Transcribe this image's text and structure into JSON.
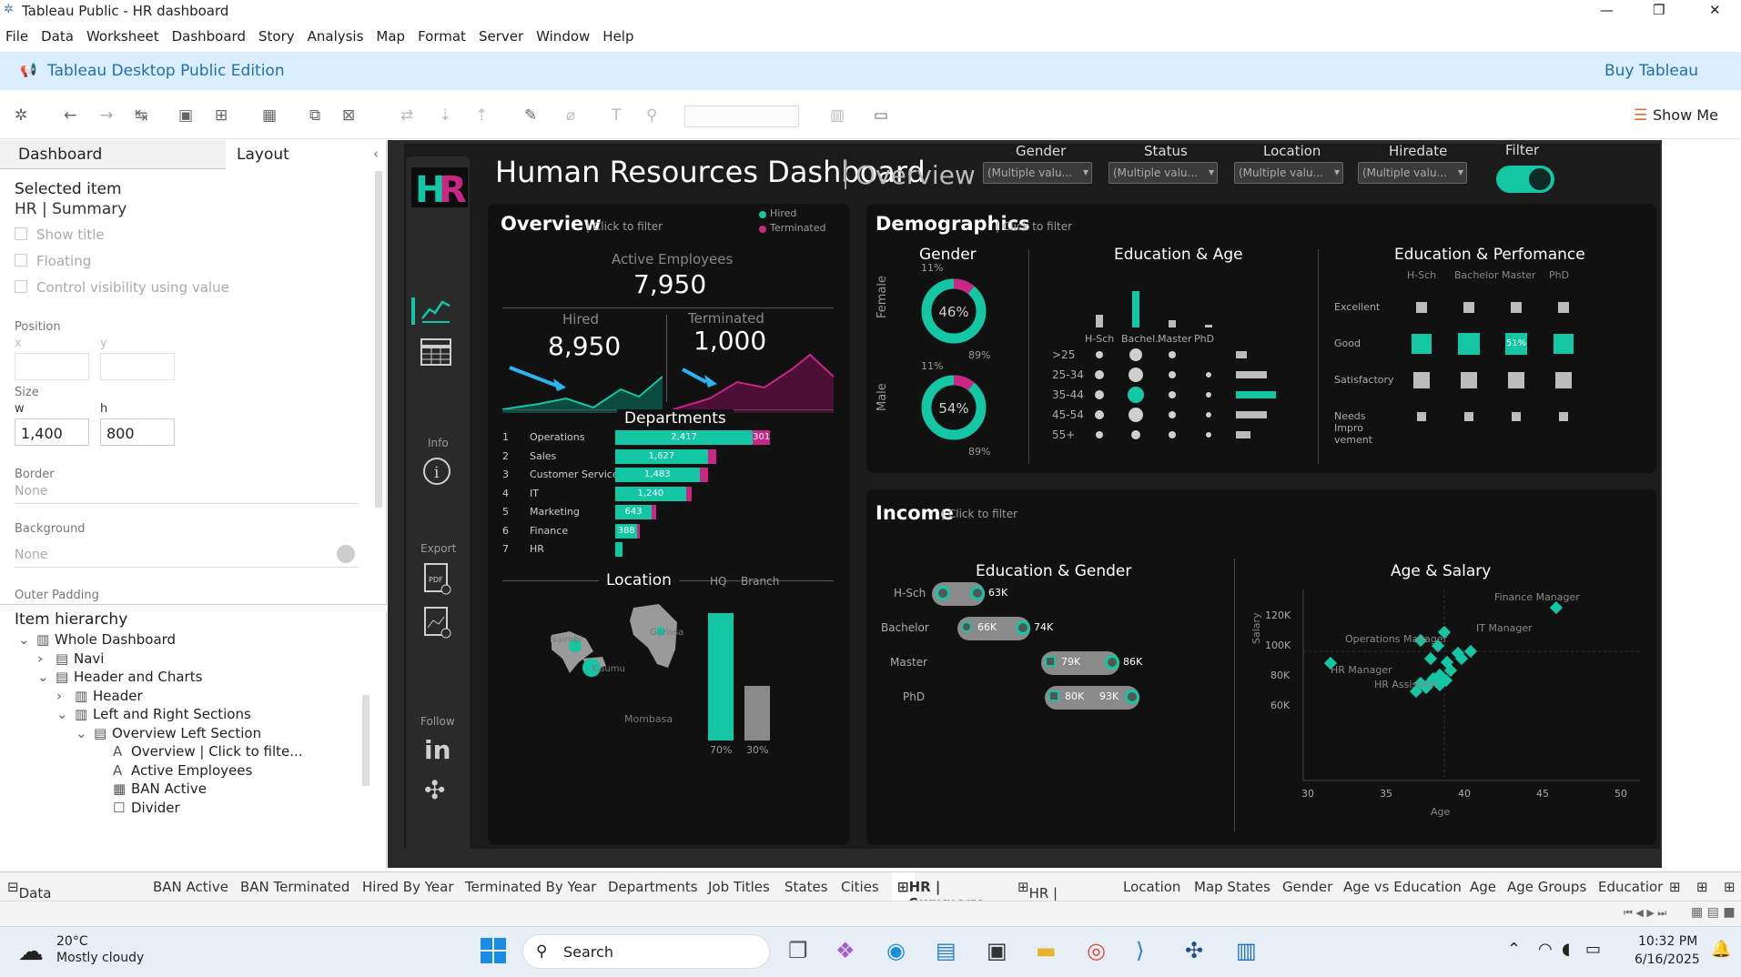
{
  "window": {
    "title": "Tableau Public - HR dashboard",
    "minimize": "—",
    "maximize": "❐",
    "close": "✕"
  },
  "menu": [
    "File",
    "Data",
    "Worksheet",
    "Dashboard",
    "Story",
    "Analysis",
    "Map",
    "Format",
    "Server",
    "Window",
    "Help"
  ],
  "edition": {
    "title": "Tableau Desktop Public Edition",
    "buy": "Buy Tableau"
  },
  "toolbar": {
    "show_me": "Show Me"
  },
  "left_panel": {
    "tabs": [
      "Dashboard",
      "Layout"
    ],
    "collapse": "‹",
    "selected_label": "Selected item",
    "selected_value": "HR | Summary",
    "checkboxes": [
      "Show title",
      "Floating",
      "Control visibility using value"
    ],
    "position_label": "Position",
    "x_label": "x",
    "y_label": "y",
    "size_label": "Size",
    "w_label": "w",
    "h_label": "h",
    "w_value": "1,400",
    "h_value": "800",
    "border_label": "Border",
    "border_value": "None",
    "background_label": "Background",
    "background_value": "None",
    "outer_padding": "Outer Padding",
    "hierarchy_label": "Item hierarchy",
    "tree": [
      {
        "label": "Whole Dashboard",
        "level": 0,
        "arrow": "⌄",
        "icon": "▥"
      },
      {
        "label": "Navi",
        "level": 1,
        "arrow": "›",
        "icon": "▤"
      },
      {
        "label": "Header and Charts",
        "level": 1,
        "arrow": "⌄",
        "icon": "▤"
      },
      {
        "label": "Header",
        "level": 2,
        "arrow": "›",
        "icon": "▥"
      },
      {
        "label": "Left and Right Sections",
        "level": 2,
        "arrow": "⌄",
        "icon": "▥"
      },
      {
        "label": "Overview Left Section",
        "level": 3,
        "arrow": "⌄",
        "icon": "▤"
      },
      {
        "label": "Overview | Click to filte...",
        "level": 4,
        "arrow": "",
        "icon": "A"
      },
      {
        "label": "Active Employees",
        "level": 4,
        "arrow": "",
        "icon": "A"
      },
      {
        "label": "BAN Active",
        "level": 4,
        "arrow": "",
        "icon": "▦"
      },
      {
        "label": "Divider",
        "level": 4,
        "arrow": "",
        "icon": "☐"
      }
    ]
  },
  "dashboard": {
    "title": "Human Resources Dashboard",
    "subtitle": "Overview",
    "filters": [
      {
        "label": "Gender",
        "value": "(Multiple valu..."
      },
      {
        "label": "Status",
        "value": "(Multiple valu..."
      },
      {
        "label": "Location",
        "value": "(Multiple valu..."
      },
      {
        "label": "Hiredate",
        "value": "(Multiple valu..."
      }
    ],
    "filter_toggle_label": "Filter",
    "nav": {
      "info": "Info",
      "export": "Export",
      "follow": "Follow"
    },
    "overview": {
      "title": "Overview",
      "hint": "Click to filter",
      "legend": [
        "Hired",
        "Terminated"
      ],
      "active_label": "Active Employees",
      "active_value": "7,950",
      "hired_label": "Hired",
      "hired_value": "8,950",
      "terminated_label": "Terminated",
      "terminated_value": "1,000",
      "departments_title": "Departments",
      "departments": [
        {
          "rank": "1",
          "name": "Operations",
          "hired": 2417,
          "hired_label": "2,417",
          "term": 301,
          "term_label": "301"
        },
        {
          "rank": "2",
          "name": "Sales",
          "hired": 1627,
          "hired_label": "1,627",
          "term": 150,
          "term_label": ""
        },
        {
          "rank": "3",
          "name": "Customer Service",
          "hired": 1483,
          "hired_label": "1,483",
          "term": 140,
          "term_label": ""
        },
        {
          "rank": "4",
          "name": "IT",
          "hired": 1240,
          "hired_label": "1,240",
          "term": 110,
          "term_label": ""
        },
        {
          "rank": "5",
          "name": "Marketing",
          "hired": 643,
          "hired_label": "643",
          "term": 70,
          "term_label": ""
        },
        {
          "rank": "6",
          "name": "Finance",
          "hired": 388,
          "hired_label": "388",
          "term": 40,
          "term_label": ""
        },
        {
          "rank": "7",
          "name": "HR",
          "hired": 120,
          "hired_label": "",
          "term": 0,
          "term_label": ""
        }
      ],
      "location_title": "Location",
      "map_labels": [
        "Nairobi",
        "Kisumu",
        "Garissa",
        "Mombasa"
      ],
      "hq_label": "HQ",
      "branch_label": "Branch",
      "hq_pct": "70%",
      "branch_pct": "30%",
      "hq_share": 0.7,
      "branch_share": 0.3
    },
    "demographics": {
      "title": "Demographics",
      "hint": "Click to filter",
      "gender_title": "Gender",
      "female": {
        "label": "Female",
        "pct": "46%",
        "top": "11%",
        "bottom": "89%",
        "share": 0.11
      },
      "male": {
        "label": "Male",
        "pct": "54%",
        "top": "11%",
        "bottom": "89%",
        "share": 0.11
      },
      "edu_age_title": "Education & Age",
      "edu_levels": [
        "H-Sch",
        "Bachel..",
        "Master",
        "PhD"
      ],
      "age_groups": [
        ">25",
        "25-34",
        "35-44",
        "45-54",
        "55+"
      ],
      "edu_perf_title": "Education & Perfomance",
      "perf_cols": [
        "H-Sch",
        "Bachelor",
        "Master",
        "PhD"
      ],
      "perf_rows": [
        "Excellent",
        "Good",
        "Satisfactory",
        "Needs Impro vement"
      ],
      "perf_highlight": "51%"
    },
    "income": {
      "title": "Income",
      "hint": "Click to filter",
      "edu_gender_title": "Education & Gender",
      "rows": [
        {
          "label": "H-Sch",
          "a": "",
          "b": "63K"
        },
        {
          "label": "Bachelor",
          "a": "66K",
          "b": "74K"
        },
        {
          "label": "Master",
          "a": "79K",
          "b": "86K"
        },
        {
          "label": "PhD",
          "a": "80K",
          "b": "93K"
        }
      ],
      "age_salary_title": "Age & Salary",
      "ylabel": "Salary",
      "xlabel": "Age",
      "yticks": [
        "120K",
        "100K",
        "80K",
        "60K"
      ],
      "xticks": [
        "30",
        "35",
        "40",
        "45",
        "50"
      ],
      "point_labels": [
        "Finance Manager",
        "Operations Manager",
        "IT Manager",
        "HR Manager",
        "HR Assistant"
      ]
    }
  },
  "sheet_tabs": [
    "Data Source",
    "BAN Active",
    "BAN Terminated",
    "Hired By Year",
    "Terminated By Year",
    "Departments",
    "Job Titles",
    "States",
    "Cities",
    "HR | Summary",
    "HR | Details",
    "Location",
    "Map States",
    "Gender",
    "Age vs Education",
    "Age",
    "Age Groups",
    "Educatior"
  ],
  "taskbar": {
    "temp": "20°C",
    "weather": "Mostly cloudy",
    "search": "Search",
    "time": "10:32 PM",
    "date": "6/16/2025"
  },
  "colors": {
    "accent": "#13c7a4",
    "magenta": "#c92685",
    "arrow": "#2ab4f0",
    "edition_bg": "#dbeeff"
  }
}
